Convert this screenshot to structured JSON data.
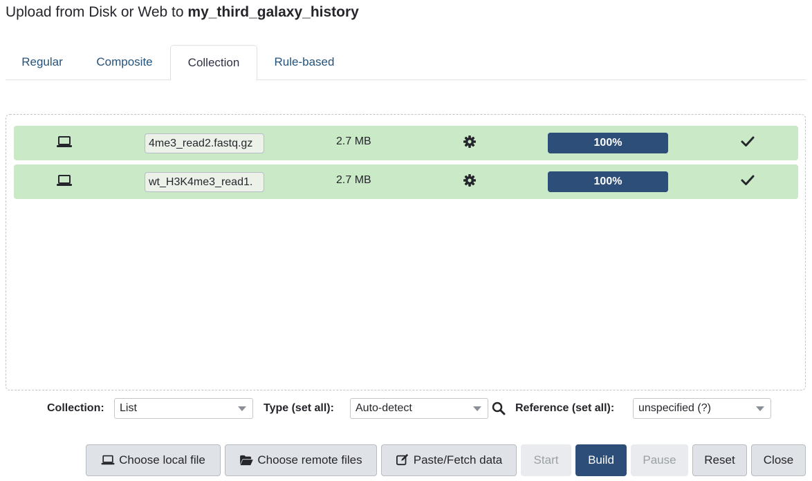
{
  "header": {
    "title_prefix": "Upload from Disk or Web to",
    "history_name": "my_third_galaxy_history"
  },
  "tabs": [
    {
      "label": "Regular"
    },
    {
      "label": "Composite"
    },
    {
      "label": "Collection",
      "active": true
    },
    {
      "label": "Rule-based"
    }
  ],
  "uploads": [
    {
      "source_icon": "laptop-icon",
      "name": "4me3_read2.fastq.gz",
      "size": "2.7 MB",
      "settings_icon": "gear-icon",
      "progress_percent": 100,
      "progress_label": "100%",
      "status_icon": "check-icon"
    },
    {
      "source_icon": "laptop-icon",
      "name": "wt_H3K4me3_read1.",
      "size": "2.7 MB",
      "settings_icon": "gear-icon",
      "progress_percent": 100,
      "progress_label": "100%",
      "status_icon": "check-icon"
    }
  ],
  "options": {
    "collection_label": "Collection:",
    "collection_value": "List",
    "type_label": "Type (set all):",
    "type_value": "Auto-detect",
    "search_icon": "search-icon",
    "reference_label": "Reference (set all):",
    "reference_value": "unspecified (?)"
  },
  "buttons": {
    "choose_local": "Choose local file",
    "choose_remote": "Choose remote files",
    "paste_fetch": "Paste/Fetch data",
    "start": "Start",
    "build": "Build",
    "pause": "Pause",
    "reset": "Reset",
    "close": "Close"
  },
  "colors": {
    "row_success": "#c9e9c7",
    "progress": "#2c4e78",
    "primary": "#2c4e78",
    "link": "#25537b"
  }
}
